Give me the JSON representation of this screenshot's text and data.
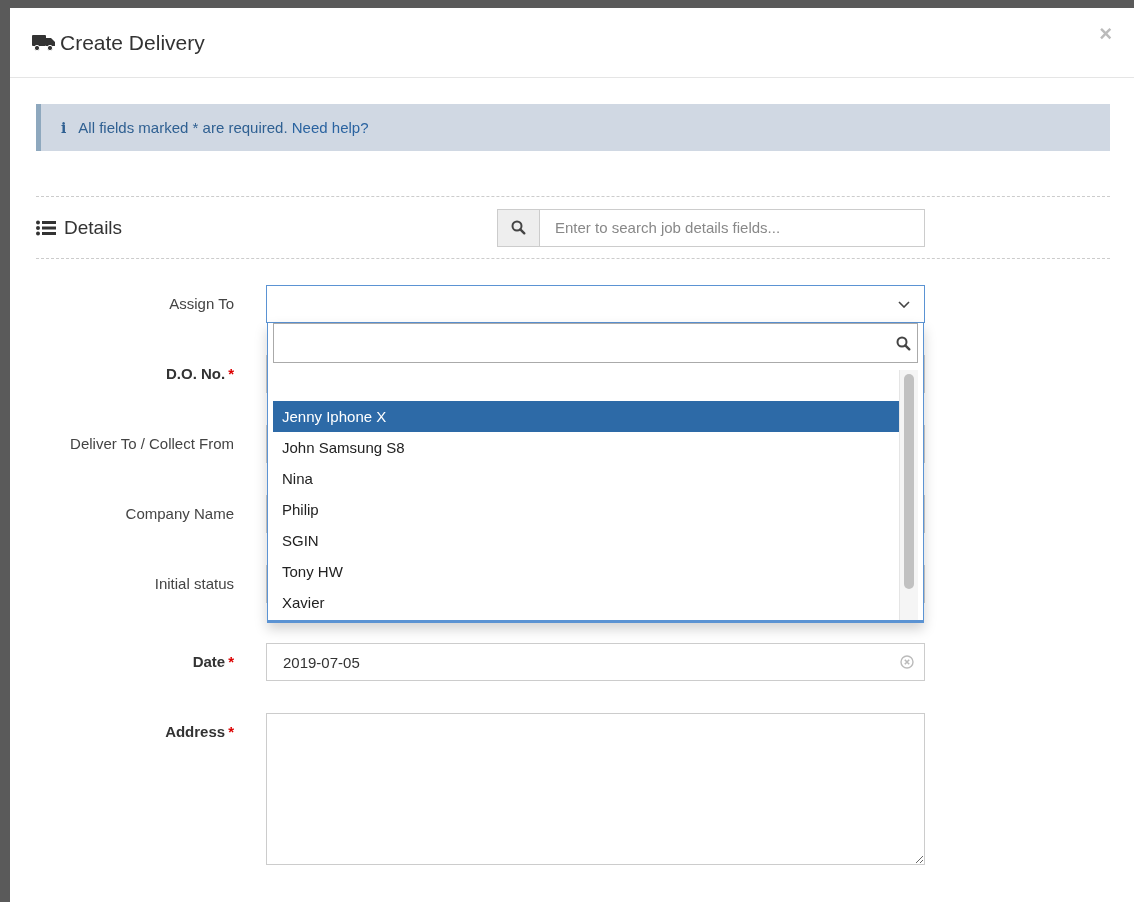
{
  "modal": {
    "title": "Create Delivery",
    "close": "×"
  },
  "alert": {
    "icon": "i",
    "text": "All fields marked * are required.",
    "link": "Need help?"
  },
  "details": {
    "title": "Details",
    "search": {
      "placeholder": "Enter to search job details fields..."
    }
  },
  "fields": [
    {
      "label": "Assign To",
      "kind": "select"
    },
    {
      "label": "D.O. No.",
      "marker": "*",
      "kind": "text"
    },
    {
      "label": "Deliver To / Collect From",
      "kind": "text"
    },
    {
      "label": "Company Name",
      "kind": "text"
    },
    {
      "label": "Initial status",
      "kind": "text"
    },
    {
      "label": "Date",
      "marker": "*",
      "kind": "date",
      "value": "2019-07-05"
    },
    {
      "label": "Address",
      "marker": "*",
      "kind": "textarea"
    }
  ],
  "dropdown": {
    "options": [
      {
        "label": "Jenny Iphone X",
        "selected": true
      },
      {
        "label": "John Samsung S8",
        "selected": false
      },
      {
        "label": "Nina",
        "selected": false
      },
      {
        "label": "Philip",
        "selected": false
      },
      {
        "label": "SGIN",
        "selected": false
      },
      {
        "label": "Tony HW",
        "selected": false
      },
      {
        "label": "Xavier",
        "selected": false
      }
    ]
  }
}
